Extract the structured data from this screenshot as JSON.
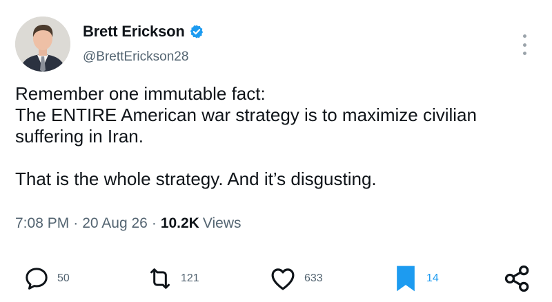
{
  "author": {
    "display_name": "Brett Erickson",
    "handle": "@BrettErickson28",
    "verified_badge_icon": "verified-badge-icon",
    "verified_color": "#1d9bf0"
  },
  "tweet": {
    "lines": [
      "Remember one immutable fact:",
      "The ENTIRE American war strategy is to maximize civilian",
      "suffering in Iran.",
      "That is the whole strategy. And it’s disgusting."
    ]
  },
  "meta": {
    "time": "7:08 PM",
    "date": "20 Aug 26",
    "views_count": "10.2K",
    "views_label": "Views",
    "separator": "·"
  },
  "actions": {
    "replies": "50",
    "retweets": "121",
    "likes": "633",
    "bookmarks": "14"
  },
  "colors": {
    "text": "#0f1419",
    "secondary": "#536471",
    "accent": "#1d9bf0"
  }
}
